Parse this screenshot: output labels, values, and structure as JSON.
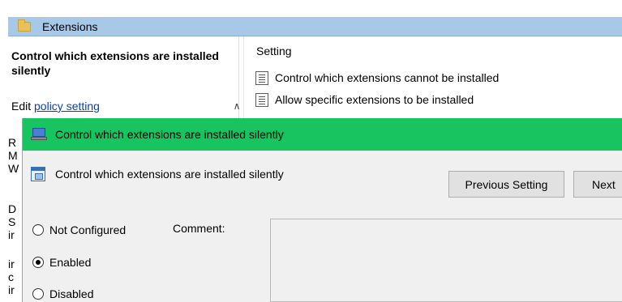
{
  "background": {
    "header_title": "Extensions",
    "left_pane": {
      "title": "Control which extensions are installed silently",
      "edit_prefix": "Edit ",
      "edit_link": "policy setting",
      "clipped_letters_top": [
        "R",
        "M",
        "W"
      ],
      "clipped_letters_bottom": [
        "D",
        "S",
        "ir",
        "ir",
        "c",
        "ir"
      ]
    },
    "right_pane": {
      "column_header": "Setting",
      "rows": [
        "Control which extensions cannot be installed",
        "Allow specific extensions to be installed"
      ]
    }
  },
  "dialog": {
    "title": "Control which extensions are installed silently",
    "subtitle": "Control which extensions are installed silently",
    "buttons": {
      "previous": "Previous Setting",
      "next": "Next"
    },
    "radios": [
      {
        "label": "Not Configured",
        "checked": false
      },
      {
        "label": "Enabled",
        "checked": true
      },
      {
        "label": "Disabled",
        "checked": false
      }
    ],
    "comment_label": "Comment:",
    "comment_value": ""
  },
  "colors": {
    "dialog_title_bg": "#17c45f",
    "header_bg": "#a8c8e8",
    "link": "#0645ad"
  }
}
